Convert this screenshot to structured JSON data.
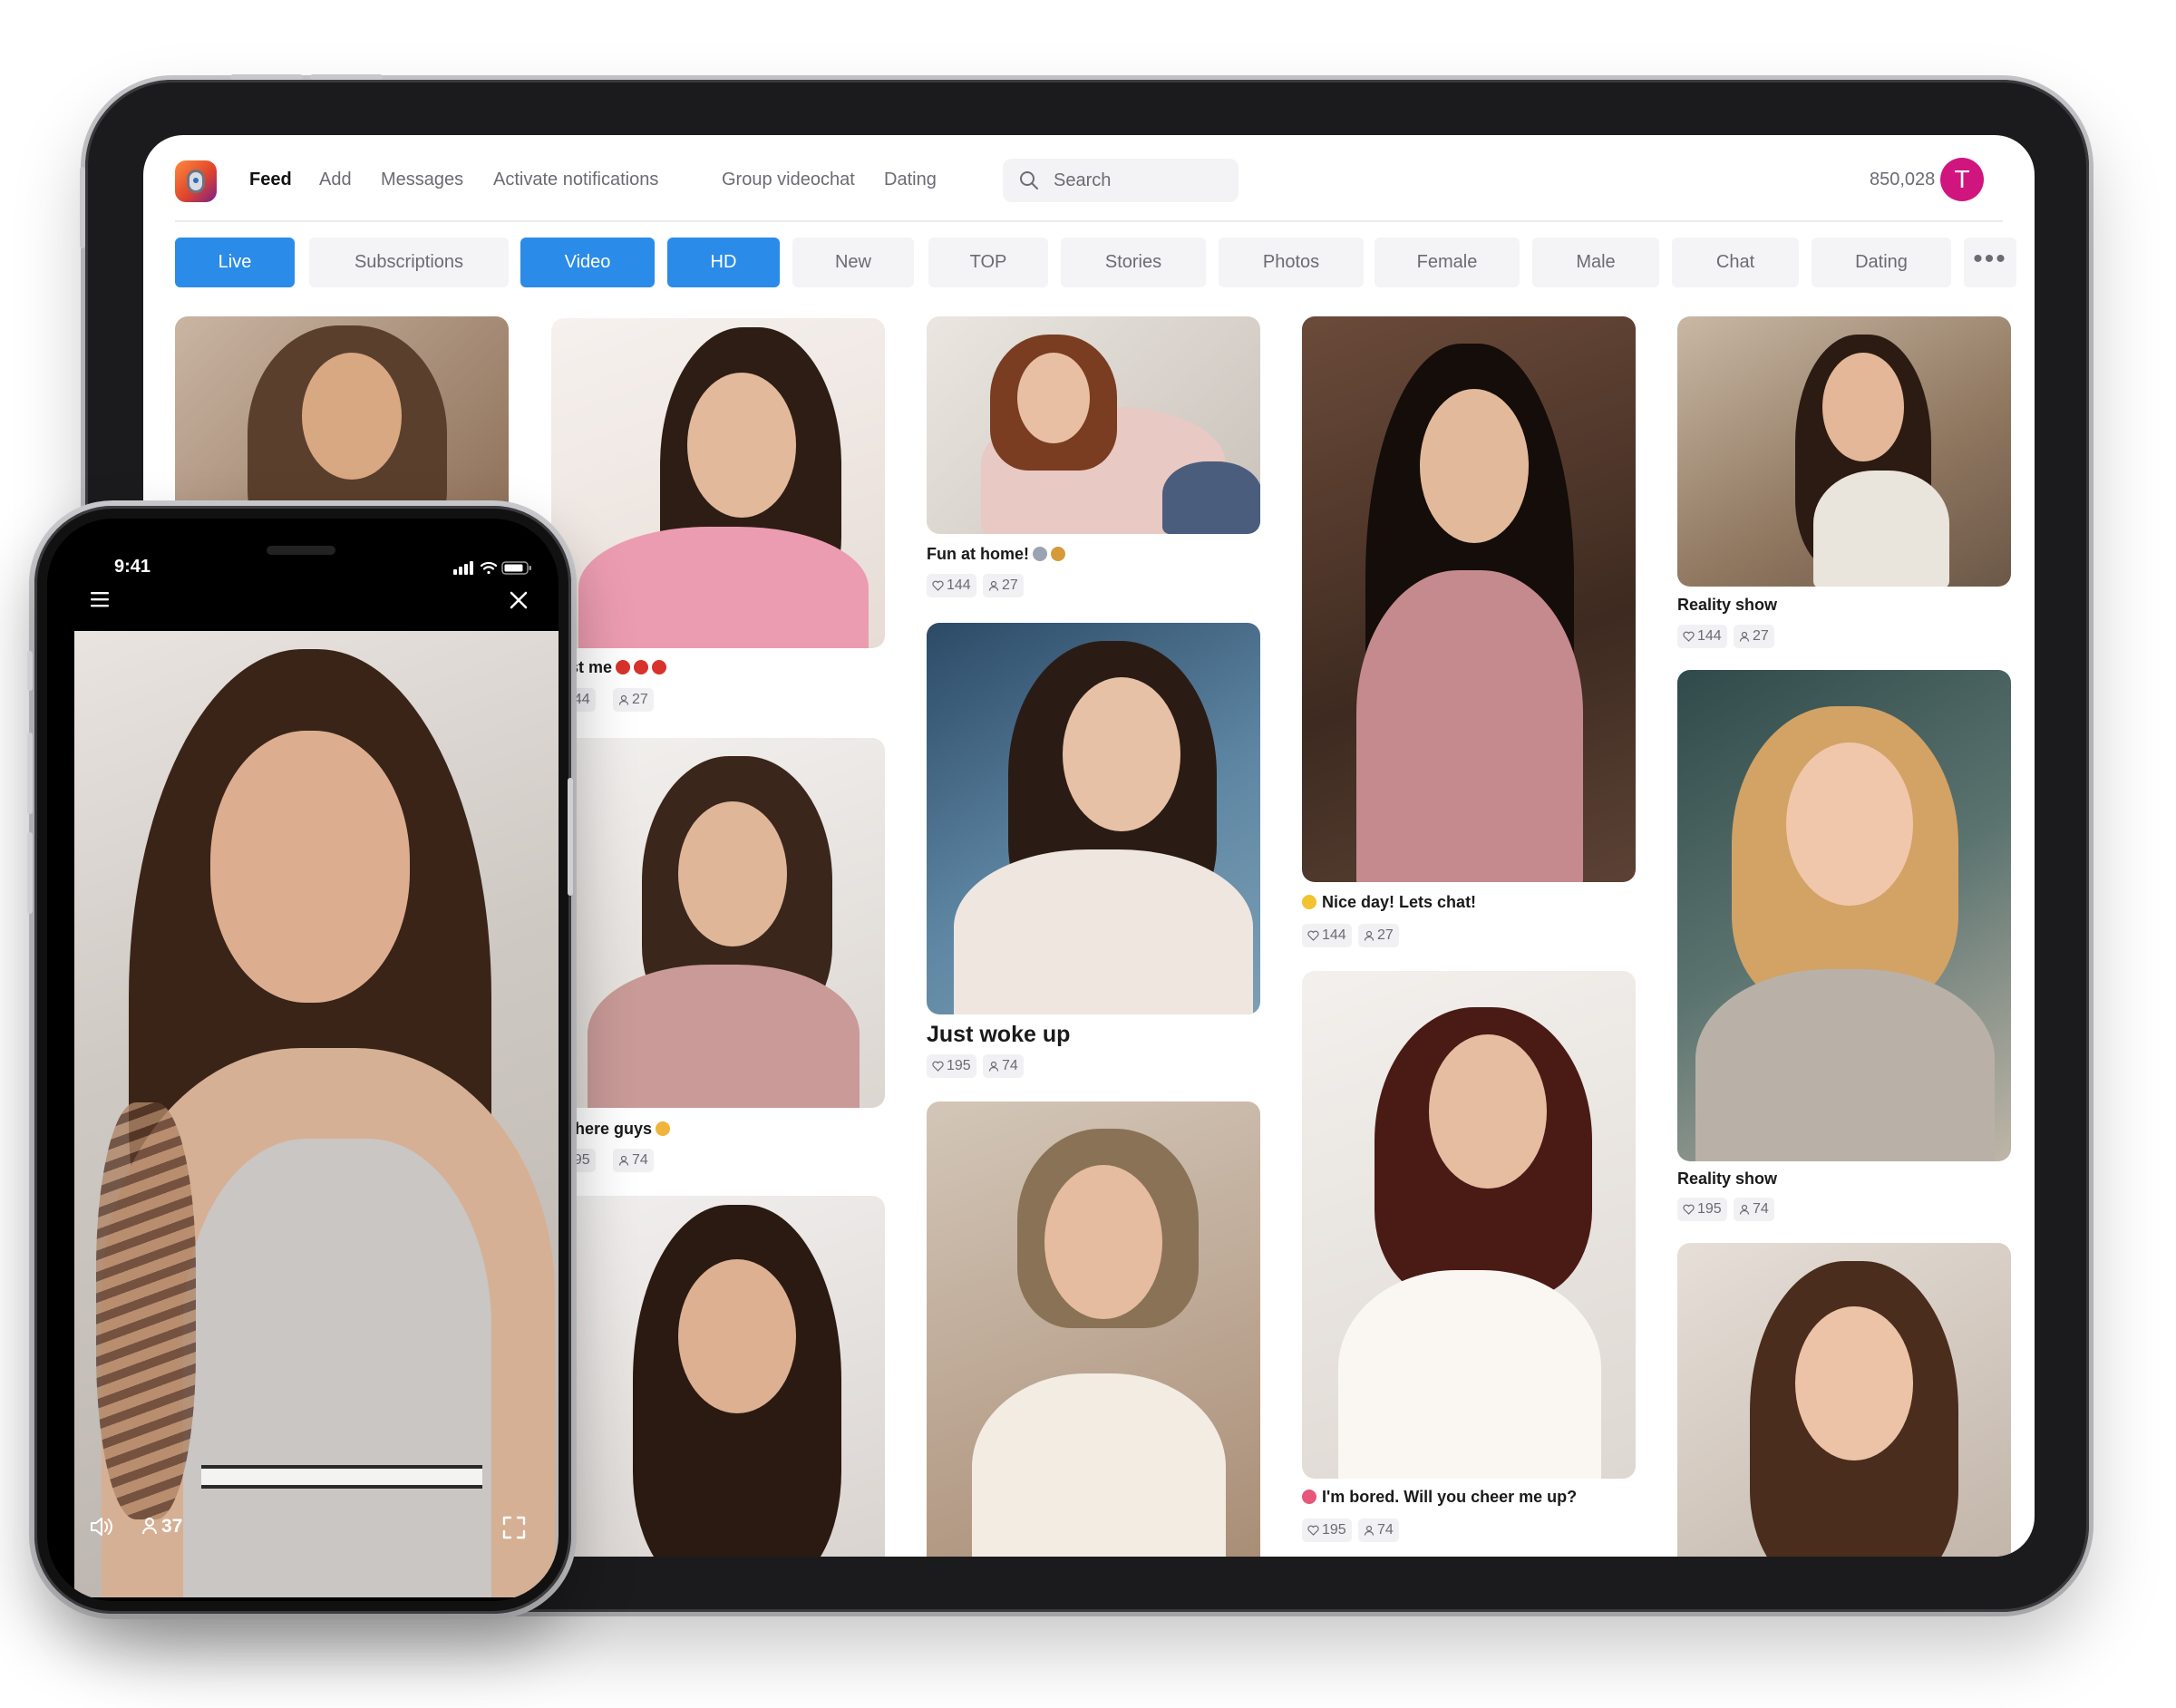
{
  "app": {
    "nav": {
      "links": [
        "Feed",
        "Add",
        "Messages",
        "Activate notifications",
        "Group videochat",
        "Dating"
      ],
      "active": "Feed"
    },
    "search": {
      "placeholder": "Search"
    },
    "counter": "850,028",
    "avatar_letter": "T",
    "accent_color": "#2b8be8",
    "avatar_color": "#d0157f"
  },
  "filters": {
    "items": [
      "Live",
      "Subscriptions",
      "Video",
      "HD",
      "New",
      "TOP",
      "Stories",
      "Photos",
      "Female",
      "Male",
      "Chat",
      "Dating"
    ],
    "active": [
      "Live",
      "Video",
      "HD"
    ],
    "more_label": "•••"
  },
  "feed": {
    "col2": [
      {
        "caption": "st me",
        "likes": "144",
        "viewers": "27",
        "emoji": "lips-icon"
      },
      {
        "caption": "there guys",
        "likes": "195",
        "viewers": "74",
        "emoji": "hand-icon"
      }
    ],
    "col3": [
      {
        "caption": "Fun at home!",
        "likes": "144",
        "viewers": "27",
        "emoji": "magnifier-icon"
      },
      {
        "caption": "Just woke up",
        "likes": "195",
        "viewers": "74"
      }
    ],
    "col4": [
      {
        "caption": "Nice day! Lets chat!",
        "likes": "144",
        "viewers": "27",
        "emoji": "smile-icon"
      },
      {
        "caption": "I'm bored. Will you cheer me up?",
        "likes": "195",
        "viewers": "74",
        "emoji": "bow-icon"
      }
    ],
    "col5": [
      {
        "caption": "Reality show",
        "likes": "144",
        "viewers": "27"
      },
      {
        "caption": "Reality show",
        "likes": "195",
        "viewers": "74"
      }
    ]
  },
  "phone": {
    "time": "9:41",
    "menu_icon": "hamburger-icon",
    "close_icon": "close-icon",
    "viewers": "37",
    "volume_icon": "speaker-icon",
    "fullscreen_icon": "fullscreen-icon"
  }
}
